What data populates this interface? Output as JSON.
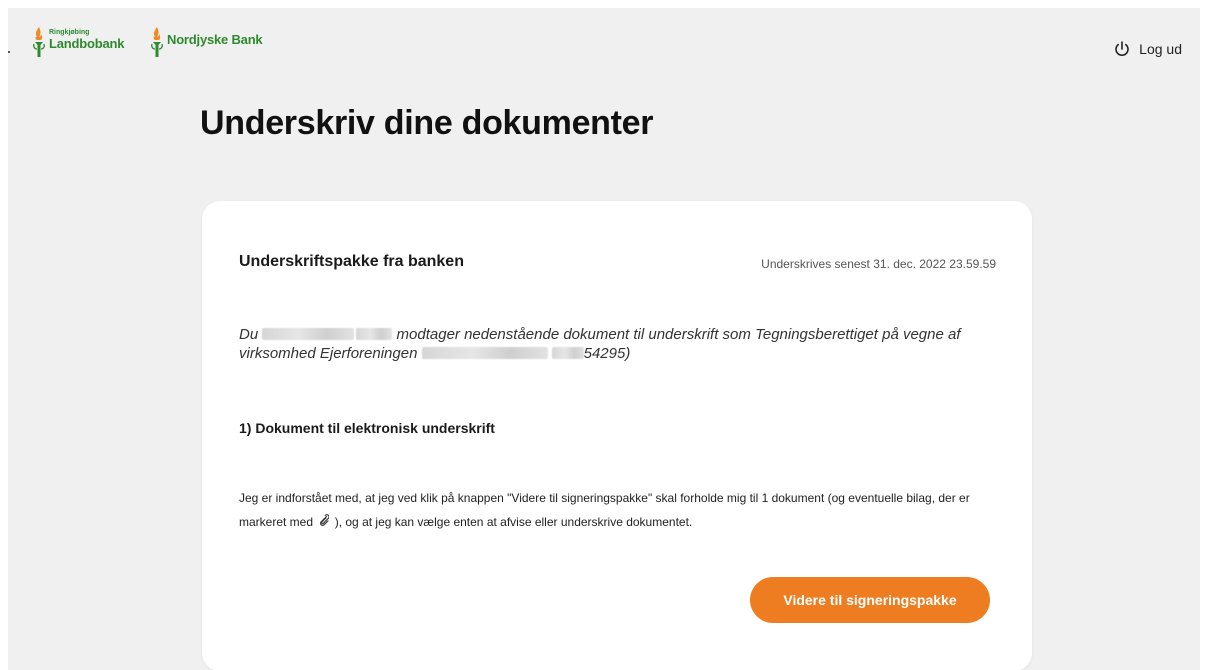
{
  "header": {
    "logos": [
      {
        "small": "Ringkjøbing",
        "big": "Landbobank"
      },
      {
        "small": "",
        "big": "Nordjyske Bank"
      }
    ],
    "logout_label": "Log ud"
  },
  "page": {
    "title": "Underskriv dine dokumenter"
  },
  "card": {
    "title": "Underskriftspakke fra banken",
    "deadline": "Underskrives senest 31. dec. 2022 23.59.59",
    "intro": {
      "part1": "Du",
      "part2": "modtager nedenstående dokument til underskrift som Tegningsberettiget på vegne af virksomhed Ejerforeningen",
      "part3": "54295)"
    },
    "section_title": "1) Dokument til elektronisk underskrift",
    "body": {
      "part1": "Jeg er indforstået med, at jeg ved klik på knappen \"Videre til signeringspakke\" skal forholde mig til 1 dokument (og eventuelle bilag, der er markeret med",
      "part2": "), og at jeg kan vælge enten at afvise eller underskrive dokumentet."
    },
    "cta_label": "Videre til signeringspakke"
  },
  "colors": {
    "background": "#f0f0f0",
    "card": "#ffffff",
    "accent": "#ee7d22",
    "logo_green": "#2e8a2e",
    "logo_flame": "#f08a24"
  },
  "icons": {
    "logout": "power-icon",
    "attachment": "paperclip-icon",
    "logo": "torch-icon"
  }
}
